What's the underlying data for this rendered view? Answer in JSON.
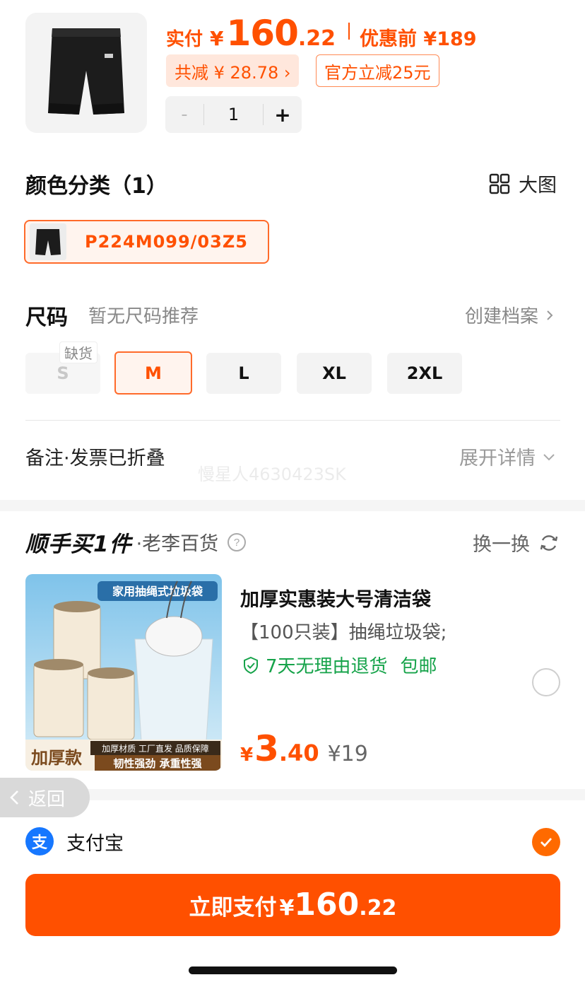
{
  "product": {
    "price_label": "实付",
    "currency": "¥",
    "price_int": "160",
    "price_dec": ".22",
    "original_price": "优惠前 ¥189",
    "total_save": "共减 ¥ 28.78 ›",
    "official_off": "官方立减25元",
    "quantity": "1",
    "minus_label": "-",
    "plus_label": "+"
  },
  "color_section": {
    "title": "颜色分类（1）",
    "big_view_label": "大图",
    "options": [
      {
        "label": "P224M099/03Z5",
        "selected": true
      }
    ]
  },
  "size_section": {
    "title": "尺码",
    "subtitle": "暂无尺码推荐",
    "create_profile": "创建档案",
    "out_of_stock": "缺货",
    "sizes": [
      {
        "label": "S",
        "state": "disabled"
      },
      {
        "label": "M",
        "state": "selected"
      },
      {
        "label": "L",
        "state": "normal"
      },
      {
        "label": "XL",
        "state": "normal"
      },
      {
        "label": "2XL",
        "state": "normal"
      }
    ]
  },
  "remark": {
    "label": "备注·发票已折叠",
    "expand": "展开详情",
    "watermark": "慢星人4630423SK"
  },
  "buy_one": {
    "brand": "顺手买1件",
    "shop": "·老李百货",
    "swap_label": "换一换",
    "item": {
      "image_caption_top": "家用抽绳式垃圾袋",
      "image_caption_left": "加厚款",
      "image_caption_right1": "加厚材质 工厂直发 品质保障",
      "image_caption_right2": "韧性强劲 承重性强",
      "name": "加厚实惠装大号清洁袋",
      "desc": "【100只装】抽绳垃圾袋;",
      "returns": "7天无理由退货",
      "shipping": "包邮",
      "currency": "¥",
      "price_int": "3",
      "price_dec": ".40",
      "original_price": "¥19",
      "selected": false
    }
  },
  "back_label": "返回",
  "payment": {
    "method": "支付宝",
    "method_icon_glyph": "支",
    "selected": true,
    "button_label": "立即支付",
    "currency": "¥",
    "amount_int": "160",
    "amount_dec": ".22"
  },
  "colors": {
    "accent": "#ff5000",
    "green": "#16a34a",
    "alipay": "#1677ff"
  }
}
